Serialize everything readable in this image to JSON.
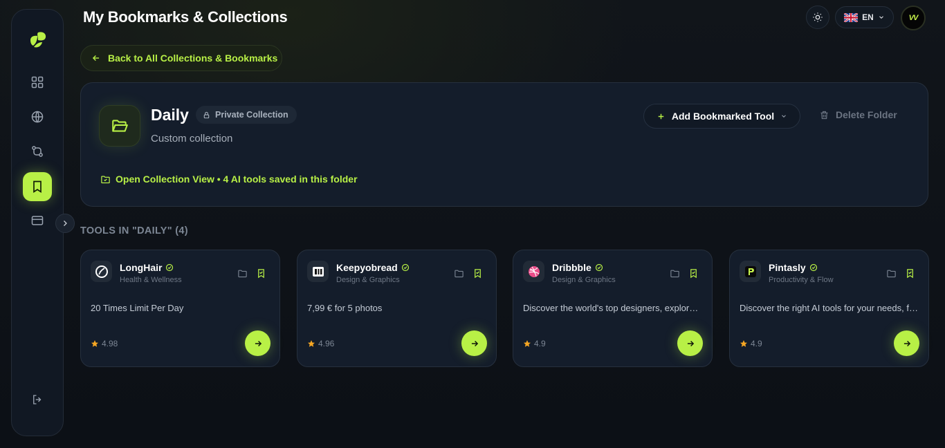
{
  "header": {
    "title": "My Bookmarks & Collections",
    "language": "EN",
    "avatar_text": "VV"
  },
  "sidebar": {
    "items": [
      {
        "name": "dashboard",
        "icon": "grid-icon"
      },
      {
        "name": "explore",
        "icon": "globe-icon"
      },
      {
        "name": "workflows",
        "icon": "git-compare-icon"
      },
      {
        "name": "bookmarks",
        "icon": "bookmark-icon",
        "active": true
      },
      {
        "name": "billing",
        "icon": "credit-card-icon"
      }
    ],
    "logout_icon": "logout-icon"
  },
  "back_button": {
    "label": "Back to All Collections & Bookmarks"
  },
  "collection": {
    "name": "Daily",
    "badge": "Private Collection",
    "description": "Custom collection",
    "open_view": "Open Collection View • 4 AI tools saved in this folder",
    "add_button": "Add Bookmarked Tool",
    "delete_button": "Delete Folder"
  },
  "section_title": "TOOLS IN \"DAILY\" (4)",
  "tools": [
    {
      "name": "LongHair",
      "category": "Health & Wellness",
      "description": "20 Times Limit Per Day",
      "rating": "4.98",
      "icon": "longhair-logo-icon"
    },
    {
      "name": "Keepyobread",
      "category": "Design & Graphics",
      "description": "7,99 € for 5 photos",
      "rating": "4.96",
      "icon": "keepyobread-logo-icon"
    },
    {
      "name": "Dribbble",
      "category": "Design & Graphics",
      "description": "Discover the world's top designers, explore their work and hire them",
      "rating": "4.9",
      "icon": "dribbble-logo-icon"
    },
    {
      "name": "Pintasly",
      "category": "Productivity & Flow",
      "description": "Discover the right AI tools for your needs, fast",
      "rating": "4.9",
      "icon": "pintasly-logo-icon"
    }
  ],
  "colors": {
    "accent": "#b8f046",
    "background": "#0d1117",
    "card": "#141d2b"
  }
}
